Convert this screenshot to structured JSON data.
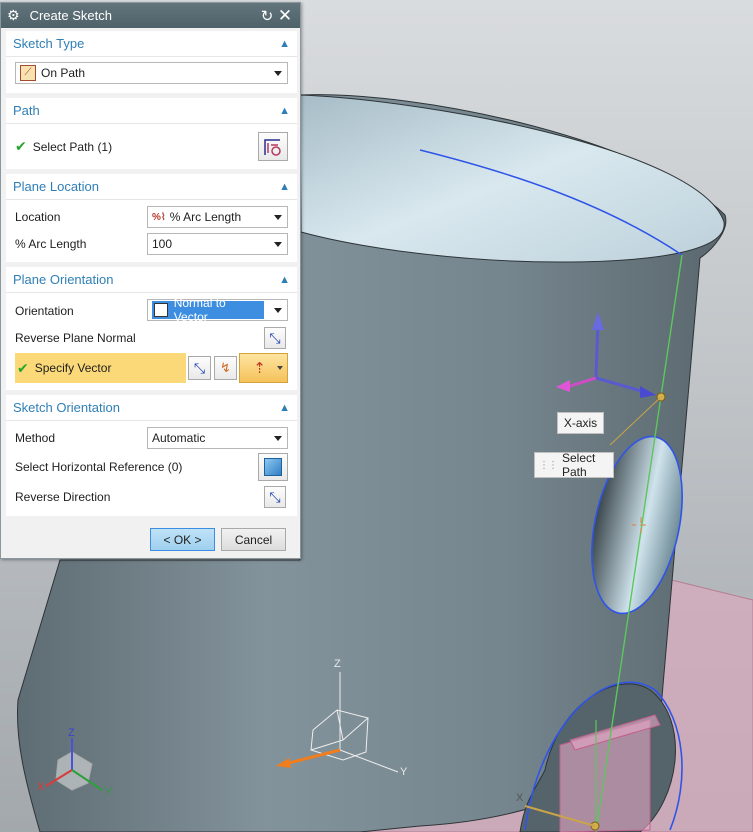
{
  "dialog": {
    "title": "Create Sketch",
    "sketch_type": {
      "header": "Sketch Type",
      "value": "On Path"
    },
    "path": {
      "header": "Path",
      "select_label": "Select Path (1)"
    },
    "plane_location": {
      "header": "Plane Location",
      "location_label": "Location",
      "location_value": "% Arc Length",
      "arc_length_label": "% Arc Length",
      "arc_length_value": "100"
    },
    "plane_orientation": {
      "header": "Plane Orientation",
      "orientation_label": "Orientation",
      "orientation_value": "Normal to Vector",
      "reverse_label": "Reverse Plane Normal",
      "specify_vector_label": "Specify Vector"
    },
    "sketch_orientation": {
      "header": "Sketch Orientation",
      "method_label": "Method",
      "method_value": "Automatic",
      "horizontal_ref_label": "Select Horizontal Reference (0)",
      "reverse_direction_label": "Reverse Direction"
    },
    "buttons": {
      "ok": "< OK >",
      "cancel": "Cancel"
    }
  },
  "viewport": {
    "tooltip_x_axis": "X-axis",
    "tooltip_select_path": "Select Path",
    "triad_labels": {
      "x": "X",
      "y": "Y",
      "z": "Z"
    }
  },
  "colors": {
    "accent": "#2f7fb6",
    "title_bar": "#54666e",
    "highlight_row": "#fbd978",
    "selected_combo": "#3d8ee0",
    "part_body": "#7f8f97",
    "path_curve": "#2f55e8",
    "sketch_plane": "#d7a9bc"
  }
}
